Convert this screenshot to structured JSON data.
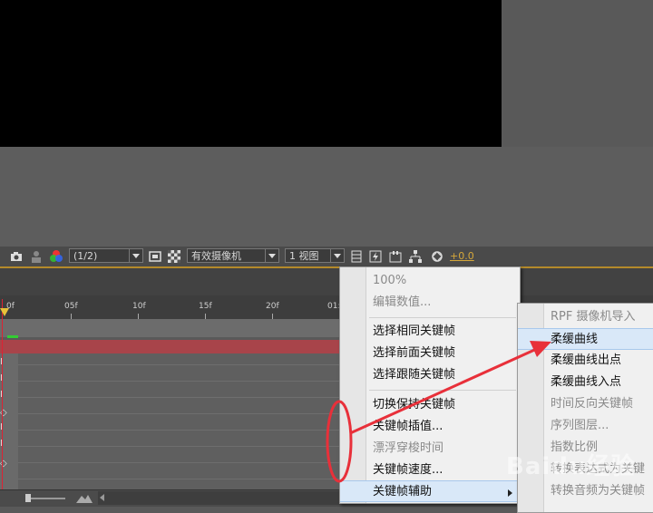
{
  "toolbar": {
    "resolution": "(1/2)",
    "camera": "有效摄像机",
    "views": "1 视图",
    "exposure": "+0.0"
  },
  "ruler": {
    "ticks": [
      "0f",
      "05f",
      "10f",
      "15f",
      "20f",
      "01:"
    ]
  },
  "context_menu": {
    "items": [
      {
        "label": "100%",
        "disabled": true
      },
      {
        "label": "编辑数值...",
        "disabled": true
      },
      {
        "label": "选择相同关键帧",
        "disabled": false
      },
      {
        "label": "选择前面关键帧",
        "disabled": false
      },
      {
        "label": "选择跟随关键帧",
        "disabled": false
      },
      {
        "label": "切换保持关键帧",
        "disabled": false
      },
      {
        "label": "关键帧插值...",
        "disabled": false
      },
      {
        "label": "漂浮穿梭时间",
        "disabled": true
      },
      {
        "label": "关键帧速度...",
        "disabled": false
      },
      {
        "label": "关键帧辅助",
        "disabled": false,
        "submenu": true,
        "highlighted": true
      }
    ]
  },
  "submenu": {
    "items": [
      {
        "label": "RPF 摄像机导入",
        "disabled": true
      },
      {
        "label": "柔缓曲线",
        "disabled": false,
        "highlighted": true
      },
      {
        "label": "柔缓曲线出点",
        "disabled": false
      },
      {
        "label": "柔缓曲线入点",
        "disabled": false
      },
      {
        "label": "时间反向关键帧",
        "disabled": true
      },
      {
        "label": "序列图层...",
        "disabled": true
      },
      {
        "label": "指数比例",
        "disabled": true
      },
      {
        "label": "转换表达式为关键",
        "disabled": true
      },
      {
        "label": "转换音频为关键帧",
        "disabled": true
      }
    ]
  },
  "annotation": {
    "color": "#e8303a"
  },
  "watermark": "Baidu经验"
}
